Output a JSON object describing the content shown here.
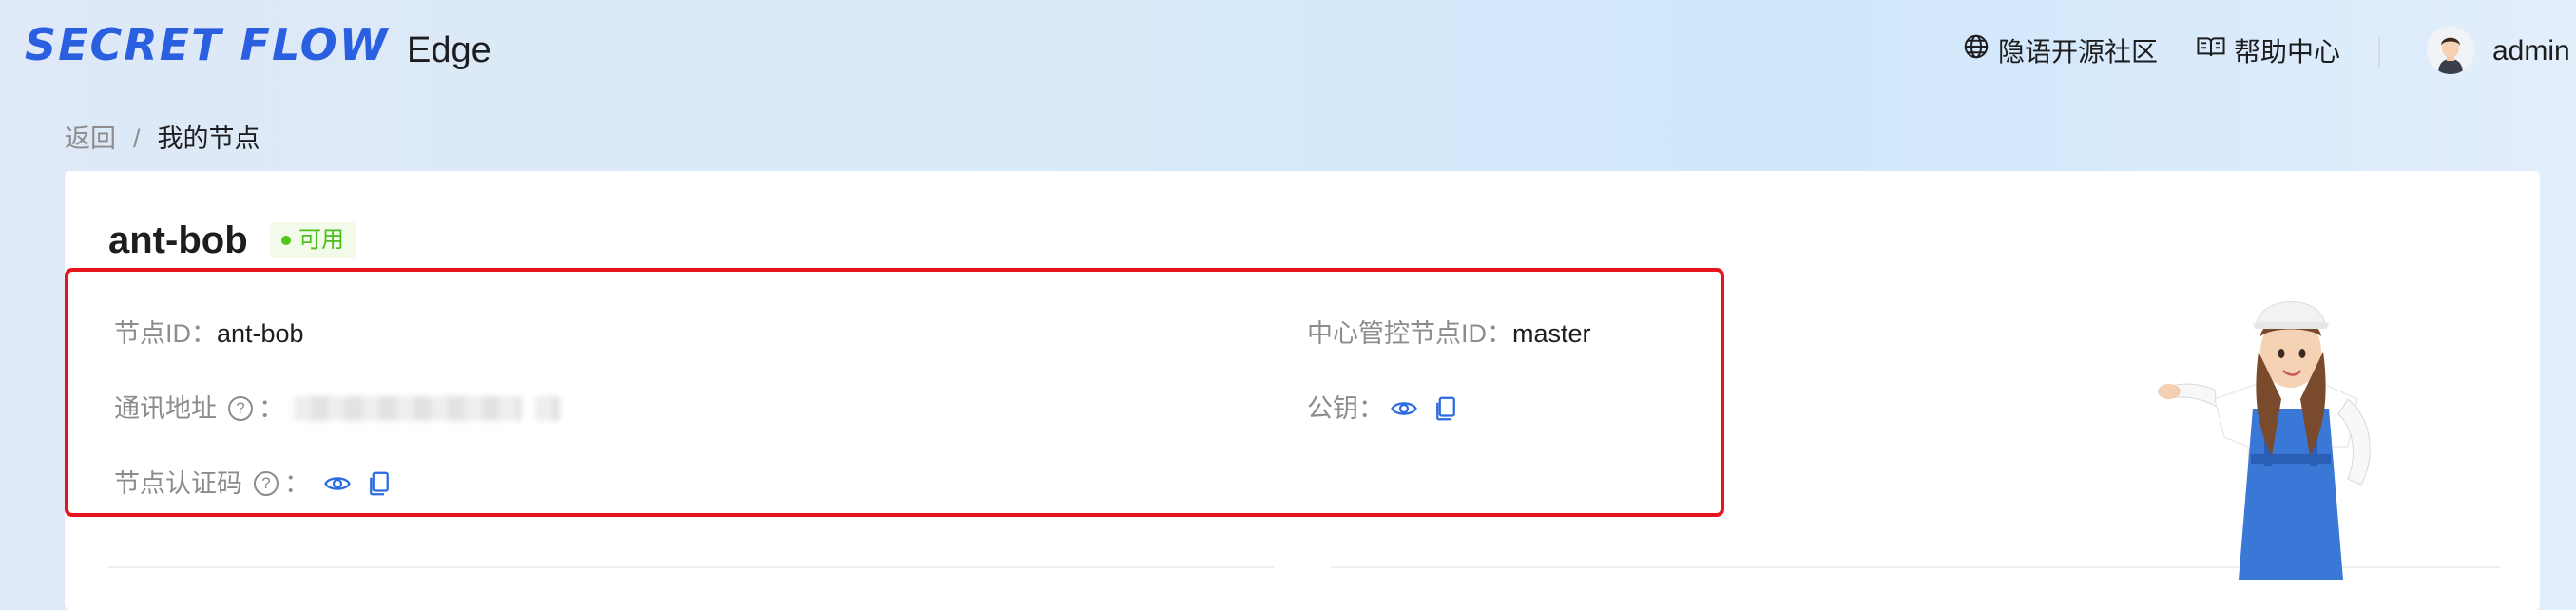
{
  "header": {
    "logo": "SECRET FLOW",
    "product": "Edge",
    "community_link": "隐语开源社区",
    "help_link": "帮助中心",
    "username": "admin"
  },
  "breadcrumb": {
    "back": "返回",
    "separator": "/",
    "current": "我的节点"
  },
  "node": {
    "name": "ant-bob",
    "status": "可用",
    "status_color": "#52c41a",
    "fields": {
      "node_id_label": "节点ID：",
      "node_id_value": "ant-bob",
      "comm_addr_label": "通讯地址",
      "comm_addr_colon": "：",
      "auth_code_label": "节点认证码",
      "auth_code_colon": "：",
      "master_id_label": "中心管控节点ID：",
      "master_id_value": "master",
      "pubkey_label": "公钥："
    }
  },
  "colors": {
    "accent": "#2a6ce0",
    "highlight_border": "#e8141d"
  }
}
